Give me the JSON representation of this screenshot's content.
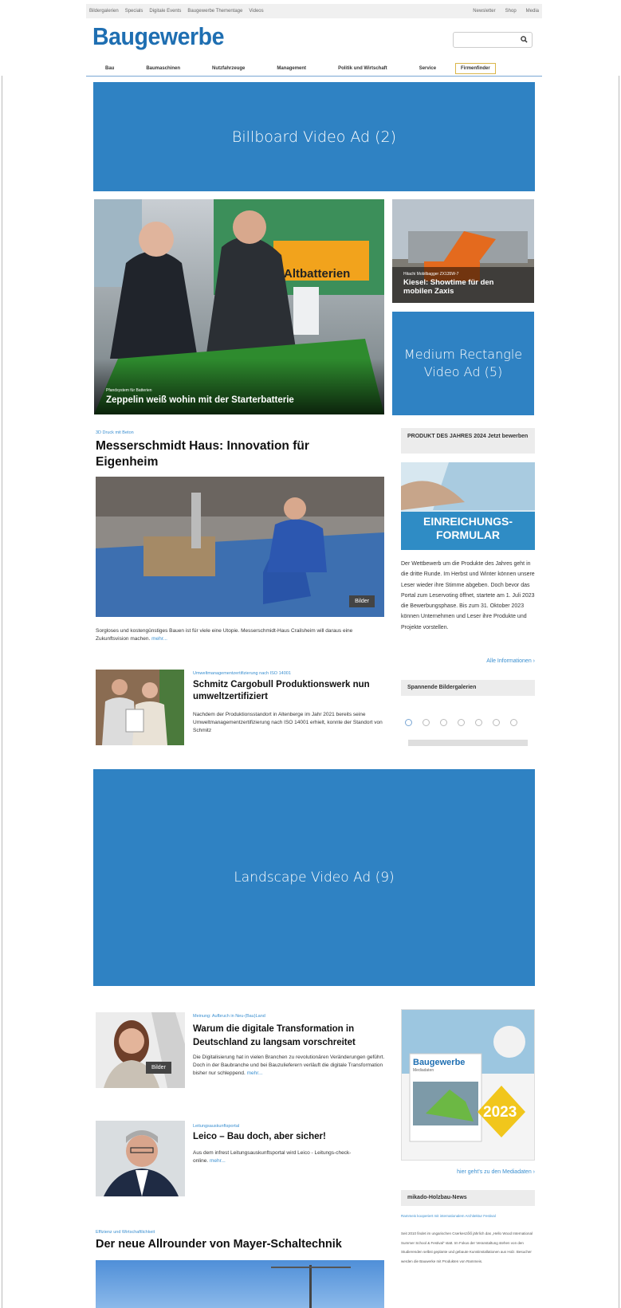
{
  "topnav": {
    "left": [
      "Bildergalerien",
      "Specials",
      "Digitale Events",
      "Baugewerbe Thementage",
      "Videos"
    ],
    "right": [
      "Newsletter",
      "Shop",
      "Media"
    ]
  },
  "header": {
    "logo": "Baugewerbe",
    "brand_color": "#1f6fb2",
    "search_placeholder": "",
    "search_icon": "search-icon"
  },
  "mainnav": [
    "Bau",
    "Baumaschinen",
    "Nutzfahrzeuge",
    "Management",
    "Politik und Wirtschaft",
    "Service"
  ],
  "mainnav_boxed": "Firmenfinder",
  "ads": {
    "billboard": "Billboard Video Ad (2)",
    "medium_rectangle": "Medium Rectangle Video Ad (5)",
    "landscape": "Landscape Video Ad (9)",
    "color": "#2f82c3"
  },
  "hero": {
    "kicker": "Pfandsystem für Batterien",
    "title": "Zeppelin weiß wohin mit der Starterbatterie",
    "sign": "Altbatterien"
  },
  "teaser_right": {
    "kicker": "Hitachi Mobilbagger ZX135W-7",
    "title": "Kiesel: Showtime für den mobilen Zaxis"
  },
  "article1": {
    "kicker": "3D Druck mit Beton",
    "title": "Messerschmidt Haus: Innovation für Eigenheim",
    "badge": "Bilder",
    "text": "Sorgloses und kostengünstiges Bauen ist für viele eine Utopie. Messerschmidt-Haus Crailsheim will daraus eine Zukunftsvision machen.",
    "more": "mehr..."
  },
  "product_box": {
    "head": "PRODUKT DES JAHRES 2024 Jetzt bewerben",
    "banner_line1": "EINREICHUNGS-",
    "banner_line2": "FORMULAR",
    "text": "Der Wettbewerb um die Produkte des Jahres geht in die dritte Runde. Im Herbst und Winter können unsere Leser wieder ihre Stimme abgeben. Doch bevor das Portal zum Leservoting öffnet, startete am 1. Juli 2023 die Bewerbungsphase. Bis zum 31. Oktober 2023 können Unternehmen und Leser ihre Produkte und Projekte vorstellen.",
    "link": "Alle Informationen"
  },
  "article2": {
    "kicker": "Umweltmanagementzertifizierung nach ISO 14001",
    "title": "Schmitz Cargobull Produktionswerk nun umweltzertifiziert",
    "text": "Nachdem der Produktionsstandort in Altenberge im Jahr 2021 bereits seine Umweltmanagementzertifizierung nach ISO 14001 erhielt, konnte der Standort von Schmitz"
  },
  "gallery_box": {
    "head": "Spannende Bildergalerien"
  },
  "article3": {
    "kicker": "Meinung: Aufbruch in Neu-(Bau)Land",
    "title": "Warum die digitale Transformation in Deutschland zu langsam vorschreitet",
    "badge": "Bilder",
    "text": "Die Digitalisierung hat in vielen Branchen zu revolutionären Veränderungen geführt. Doch in der Baubranche und bei Bauzulieferern verläuft die digitale Transformation bisher nur schleppend.",
    "more": "mehr..."
  },
  "mediadaten": {
    "cover_logo": "Baugewerbe",
    "cover_sub": "Mediadaten",
    "year": "2023",
    "link": "hier geht's zu den Mediadaten"
  },
  "article4": {
    "kicker": "Leitungsauskunftsportal",
    "title": "Leico – Bau doch, aber sicher!",
    "text": "Aus dem infrest Leitungsauskunftsportal wird Leico - Leitungs-check-online.",
    "more": "mehr..."
  },
  "mikado_box": {
    "head": "mikado-Holzbau-News",
    "item_title": "Rammeis kooperiert mit internationalem Architektur Festival",
    "item_text": "Seit 2010 findet im ungarischen Cserkeszőlő jährlich das „Hello Wood International Summer School & Festival“ statt. Im Fokus der Veranstaltung stehen von den Studierenden selbst geplante und gebaute Kunstinstallationen aus Holz. Besucher werden die Bauwerke mit Produkten von Rammeis."
  },
  "article5": {
    "kicker": "Effizienz und Wirtschaftlichkeit",
    "title": "Der neue Allrounder von Mayer-Schaltechnik"
  }
}
